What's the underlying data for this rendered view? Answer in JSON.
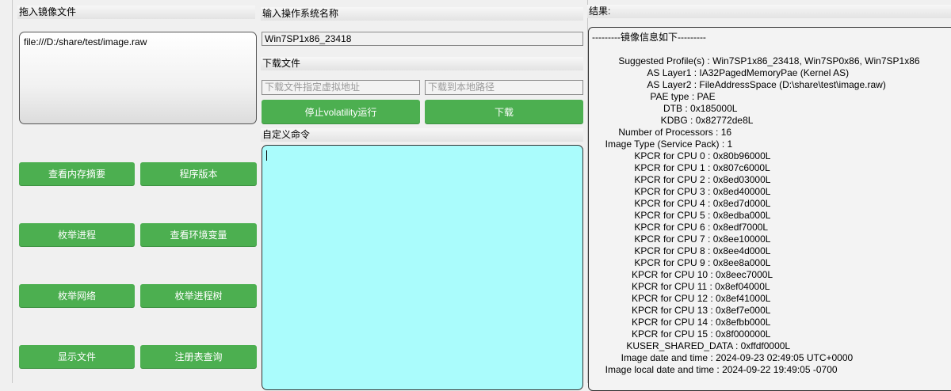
{
  "left": {
    "header": "拖入镜像文件",
    "file_path": "file:///D:/share/test/image.raw",
    "buttons": {
      "mem_summary": "查看内存摘要",
      "program_version": "程序版本",
      "enum_process": "枚举进程",
      "view_env": "查看环境变量",
      "enum_network": "枚举网络",
      "enum_process_tree": "枚举进程树",
      "show_files": "显示文件",
      "registry_query": "注册表查询"
    }
  },
  "middle": {
    "os_header": "输入操作系统名称",
    "os_value": "Win7SP1x86_23418",
    "download_header": "下载文件",
    "vaddr_placeholder": "下载文件指定虚拟地址",
    "local_path_placeholder": "下载到本地路径",
    "stop_button": "停止volatility运行",
    "download_button": "下载",
    "custom_cmd_header": "自定义命令",
    "custom_cmd_value": ""
  },
  "right": {
    "header": "结果:",
    "lines": [
      "---------镜像信息如下---------",
      "",
      "          Suggested Profile(s) : Win7SP1x86_23418, Win7SP0x86, Win7SP1x86",
      "                     AS Layer1 : IA32PagedMemoryPae (Kernel AS)",
      "                     AS Layer2 : FileAddressSpace (D:\\share\\test\\image.raw)",
      "                      PAE type : PAE",
      "                           DTB : 0x185000L",
      "                          KDBG : 0x82772de8L",
      "          Number of Processors : 16",
      "     Image Type (Service Pack) : 1",
      "                KPCR for CPU 0 : 0x80b96000L",
      "                KPCR for CPU 1 : 0x807c6000L",
      "                KPCR for CPU 2 : 0x8ed03000L",
      "                KPCR for CPU 3 : 0x8ed40000L",
      "                KPCR for CPU 4 : 0x8ed7d000L",
      "                KPCR for CPU 5 : 0x8edba000L",
      "                KPCR for CPU 6 : 0x8edf7000L",
      "                KPCR for CPU 7 : 0x8ee10000L",
      "                KPCR for CPU 8 : 0x8ee4d000L",
      "                KPCR for CPU 9 : 0x8ee8a000L",
      "               KPCR for CPU 10 : 0x8eec7000L",
      "               KPCR for CPU 11 : 0x8ef04000L",
      "               KPCR for CPU 12 : 0x8ef41000L",
      "               KPCR for CPU 13 : 0x8ef7e000L",
      "               KPCR for CPU 14 : 0x8efbb000L",
      "               KPCR for CPU 15 : 0x8f000000L",
      "             KUSER_SHARED_DATA : 0xffdf0000L",
      "           Image date and time : 2024-09-23 02:49:05 UTC+0000",
      "     Image local date and time : 2024-09-22 19:49:05 -0700"
    ]
  },
  "colors": {
    "button_green": "#4caf50",
    "cmd_area_bg": "#aafcfc"
  }
}
